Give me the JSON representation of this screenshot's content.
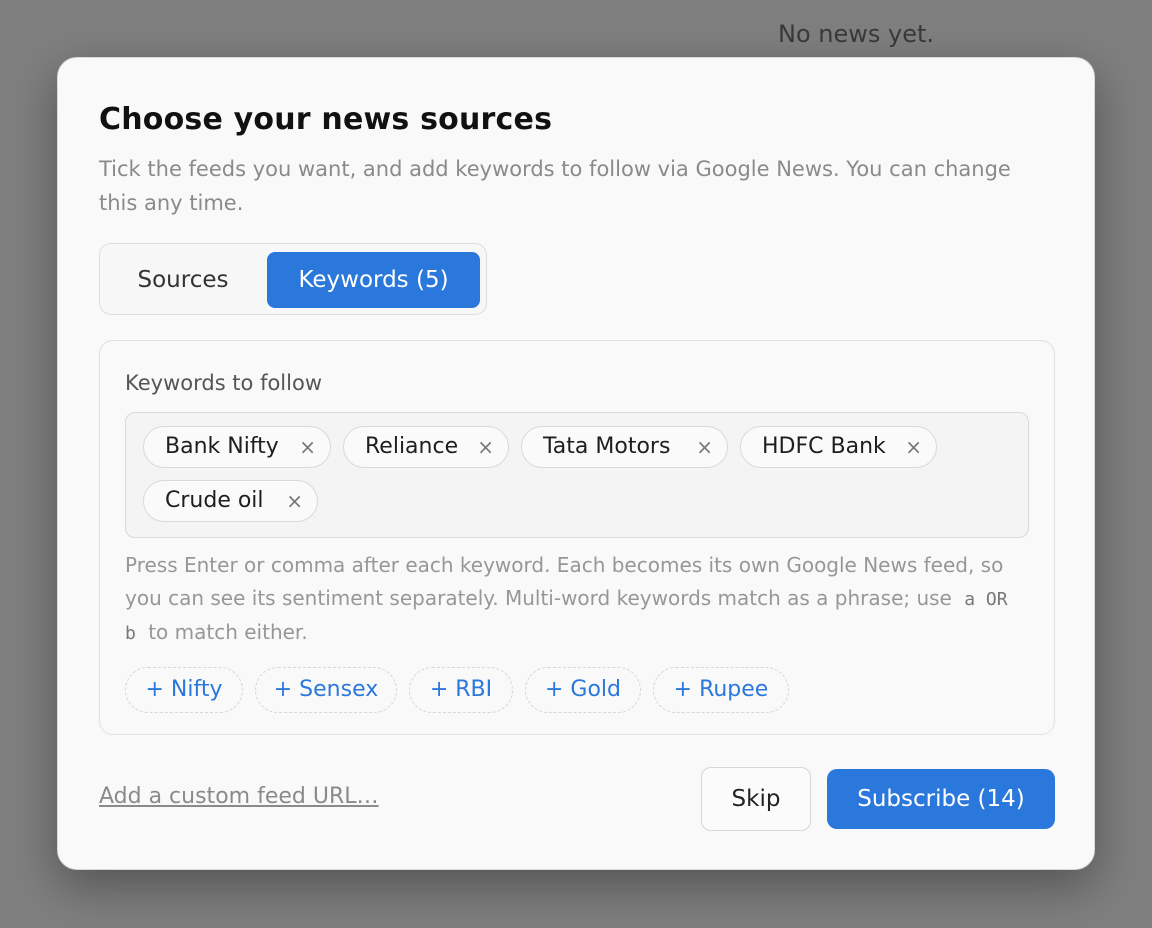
{
  "background": {
    "empty_message": "No news yet."
  },
  "modal": {
    "title": "Choose your news sources",
    "subtitle": "Tick the feeds you want, and add keywords to follow via Google News. You can change this any time."
  },
  "tabs": [
    {
      "label": "Sources",
      "active": false
    },
    {
      "label": "Keywords (5)",
      "active": true
    }
  ],
  "keywords": {
    "label": "Keywords to follow",
    "chips": [
      {
        "label": "Bank Nifty"
      },
      {
        "label": "Reliance"
      },
      {
        "label": "Tata Motors"
      },
      {
        "label": "HDFC Bank"
      },
      {
        "label": "Crude oil"
      }
    ],
    "remove_glyph": "×",
    "help": {
      "part1": "Press Enter or comma after each keyword. Each becomes its own Google News feed, so you can see its sentiment separately. Multi-word keywords match as a phrase; use",
      "code": "a OR b",
      "part2": "to match either."
    },
    "suggestions": [
      "+ Nifty",
      "+ Sensex",
      "+ RBI",
      "+ Gold",
      "+ Rupee"
    ]
  },
  "footer": {
    "custom_link": "Add a custom feed URL…",
    "skip_label": "Skip",
    "subscribe_label": "Subscribe (14)"
  },
  "colors": {
    "accent": "#2b78dc",
    "overlay": "#7f7f7f"
  }
}
